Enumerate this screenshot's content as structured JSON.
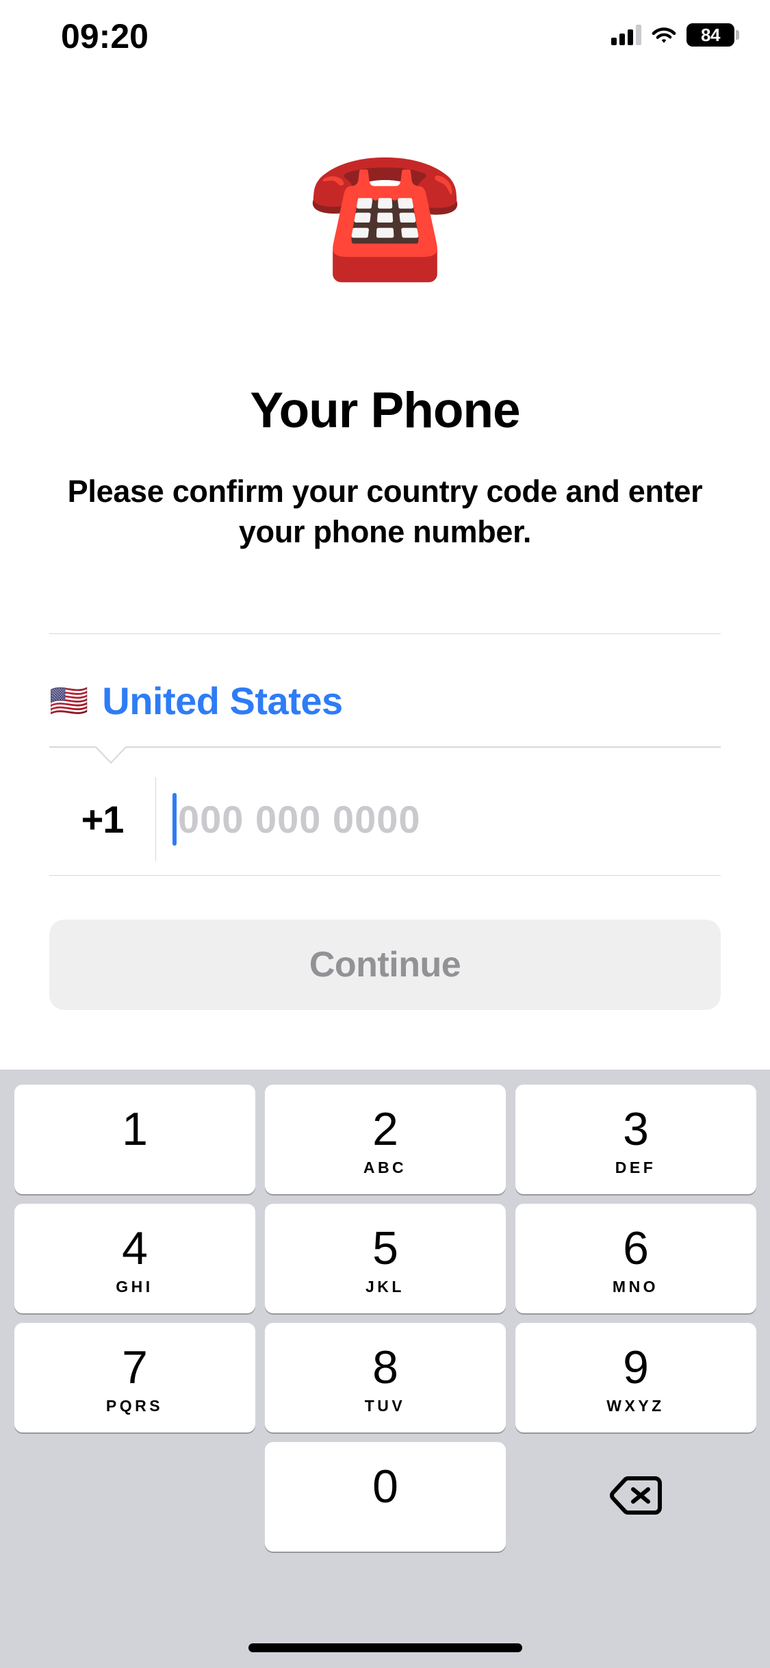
{
  "status_bar": {
    "time": "09:20",
    "battery_level": "84",
    "cellular_icon": "signal-bars-icon",
    "wifi_icon": "wifi-icon",
    "battery_icon": "battery-icon"
  },
  "hero": {
    "emoji": "☎️",
    "emoji_name": "telephone-emoji"
  },
  "header": {
    "title": "Your Phone",
    "subtitle": "Please confirm your country code and enter your phone number."
  },
  "form": {
    "country": {
      "flag": "🇺🇸",
      "name": "United States"
    },
    "phone": {
      "country_code": "+1",
      "value": "",
      "placeholder": "000 000 0000"
    }
  },
  "actions": {
    "continue_label": "Continue",
    "continue_enabled": false
  },
  "keypad": {
    "rows": [
      [
        {
          "digit": "1",
          "letters": ""
        },
        {
          "digit": "2",
          "letters": "ABC"
        },
        {
          "digit": "3",
          "letters": "DEF"
        }
      ],
      [
        {
          "digit": "4",
          "letters": "GHI"
        },
        {
          "digit": "5",
          "letters": "JKL"
        },
        {
          "digit": "6",
          "letters": "MNO"
        }
      ],
      [
        {
          "digit": "7",
          "letters": "PQRS"
        },
        {
          "digit": "8",
          "letters": "TUV"
        },
        {
          "digit": "9",
          "letters": "WXYZ"
        }
      ],
      [
        {
          "digit": "0",
          "letters": ""
        }
      ]
    ],
    "delete_icon": "backspace-icon"
  },
  "colors": {
    "accent_blue": "#2e7cf6",
    "keyboard_background": "#d1d3d9",
    "button_disabled_bg": "#efeff0",
    "button_disabled_text": "#919196",
    "placeholder_gray": "#c9c9ce",
    "separator_gray": "#d8d8dc"
  }
}
